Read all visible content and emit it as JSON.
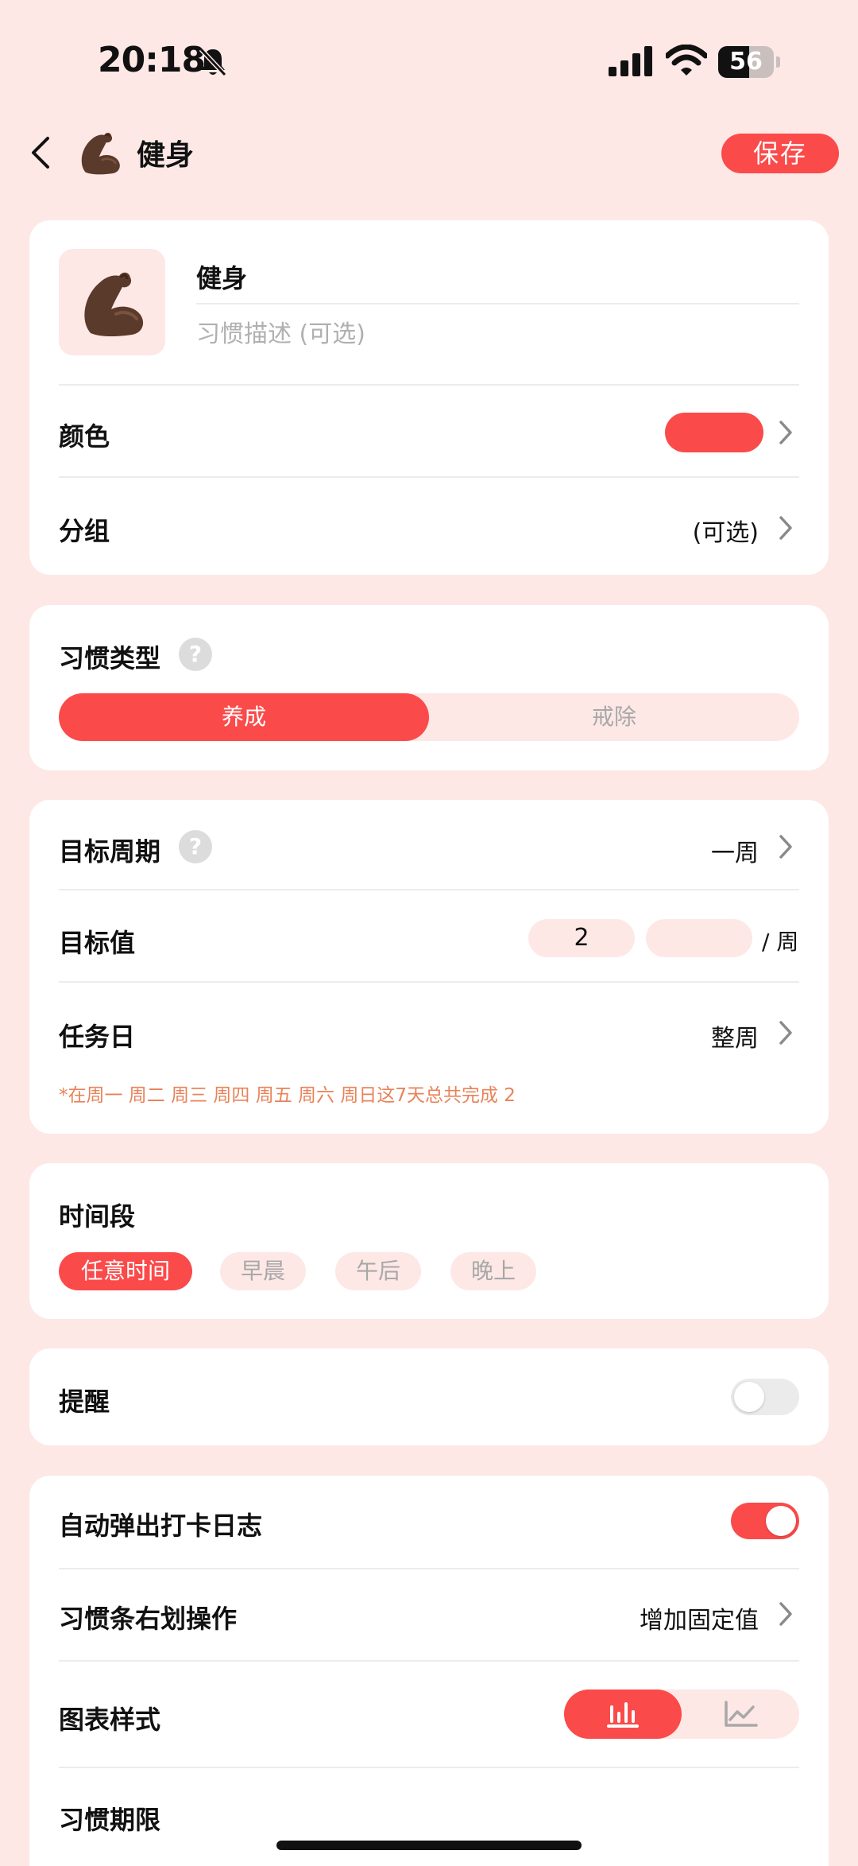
{
  "status_bar": {
    "time": "20:18",
    "battery": "56",
    "battery_level": 0.56
  },
  "nav": {
    "title": "健身",
    "save_label": "保存"
  },
  "habit": {
    "name": "健身",
    "description_placeholder": "习惯描述 (可选)",
    "color_label": "颜色",
    "color_value": "#fb4a4a",
    "group_label": "分组",
    "group_value": "(可选)"
  },
  "habit_type": {
    "label": "习惯类型",
    "options": [
      "养成",
      "戒除"
    ],
    "selected": "养成"
  },
  "goal": {
    "period_label": "目标周期",
    "period_value": "一周",
    "value_label": "目标值",
    "value_number": "2",
    "value_unit": "",
    "value_suffix": "/ 周",
    "taskday_label": "任务日",
    "taskday_value": "整周",
    "hint": "*在周一 周二 周三 周四 周五 周六 周日这7天总共完成 2"
  },
  "time_period": {
    "label": "时间段",
    "options": [
      "任意时间",
      "早晨",
      "午后",
      "晚上"
    ],
    "selected": "任意时间"
  },
  "reminder": {
    "label": "提醒",
    "enabled": false
  },
  "more": {
    "auto_log_label": "自动弹出打卡日志",
    "auto_log_enabled": true,
    "swipe_label": "习惯条右划操作",
    "swipe_value": "增加固定值",
    "chart_style_label": "图表样式",
    "chart_style_selected": "bar",
    "deadline_label": "习惯期限"
  },
  "colors": {
    "accent": "#fb4a4a",
    "background": "#fde8e6",
    "hint": "#e8835a"
  }
}
